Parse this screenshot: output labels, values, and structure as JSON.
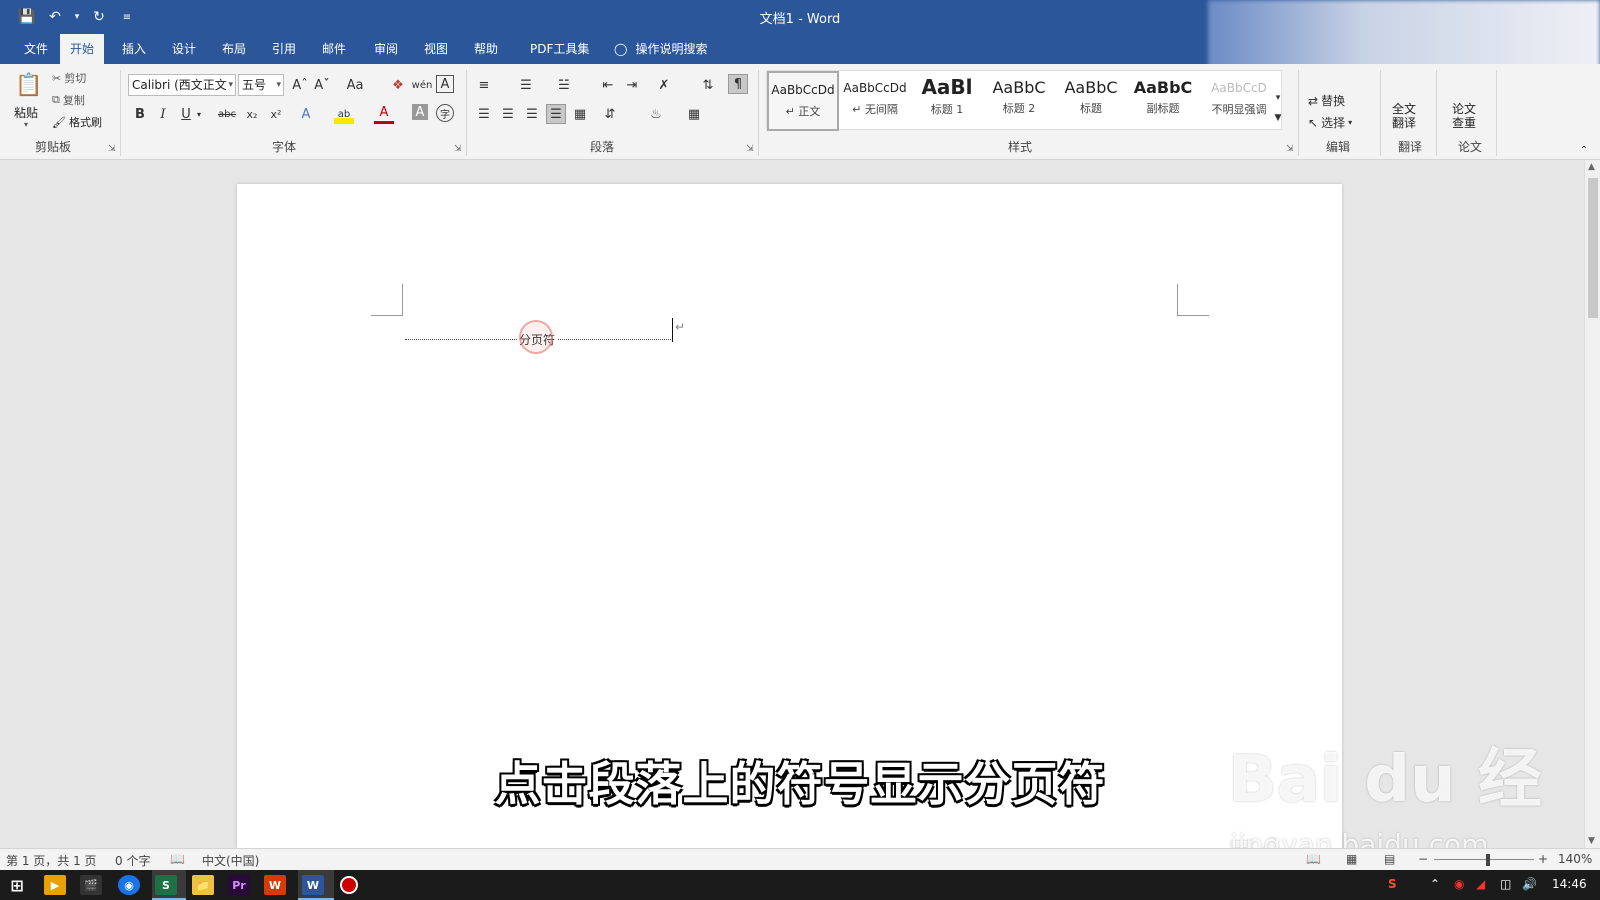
{
  "app": {
    "window_title": "文档1 - Word"
  },
  "tabs": [
    "文件",
    "开始",
    "插入",
    "设计",
    "布局",
    "引用",
    "邮件",
    "审阅",
    "视图",
    "帮助",
    "PDF工具集"
  ],
  "active_tab": "开始",
  "tell_me": "操作说明搜索",
  "clipboard": {
    "paste": "粘贴",
    "cut": "剪切",
    "copy": "复制",
    "format_painter": "格式刷",
    "group": "剪贴板"
  },
  "font": {
    "name": "Calibri (西文正文",
    "size": "五号",
    "group": "字体",
    "buttons": {
      "bold": "B",
      "italic": "I",
      "underline": "U",
      "strike": "abc",
      "sub": "x₂",
      "sup": "x²",
      "grow": "Aˆ",
      "shrink": "Aˇ",
      "case": "Aa",
      "phonetic": "wén",
      "border": "A",
      "effects": "A",
      "highlight": "ab",
      "color": "A",
      "shade": "A",
      "enclose": "字"
    }
  },
  "paragraph": {
    "group": "段落"
  },
  "styles": {
    "group": "样式",
    "items": [
      {
        "preview": "AaBbCcDd",
        "name": "↵ 正文"
      },
      {
        "preview": "AaBbCcDd",
        "name": "↵ 无间隔"
      },
      {
        "preview": "AaBl",
        "name": "标题 1"
      },
      {
        "preview": "AaBbC",
        "name": "标题 2"
      },
      {
        "preview": "AaBbC",
        "name": "标题"
      },
      {
        "preview": "AaBbC",
        "name": "副标题"
      },
      {
        "preview": "AaBbCcD",
        "name": "不明显强调"
      }
    ]
  },
  "editing": {
    "replace": "替换",
    "select": "选择",
    "group": "编辑"
  },
  "translate": {
    "full": "全文\n翻译",
    "group": "翻译"
  },
  "paper": {
    "check": "论文\n查重",
    "group": "论文"
  },
  "document": {
    "page_break_label": "分页符",
    "para_mark": "↵"
  },
  "subtitle": "点击段落上的符号显示分页符",
  "watermark": {
    "main": "Bai du 经验",
    "sub": "jingyan.baidu.com"
  },
  "status": {
    "page": "第 1 页，共 1 页",
    "words": "0 个字",
    "language": "中文(中国)",
    "zoom": "140%"
  },
  "taskbar": {
    "time": "14:46"
  }
}
